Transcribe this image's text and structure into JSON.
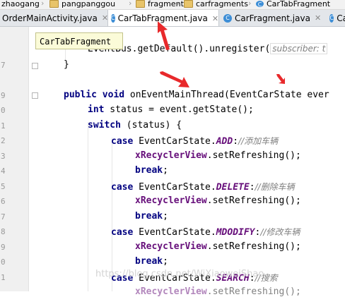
{
  "breadcrumb": {
    "items": [
      "zhaogang",
      "pangpanggou",
      "fragment",
      "carfragments",
      "CarTabFragment"
    ],
    "separator": "›"
  },
  "tabs": [
    {
      "label": "OrderMainActivity.java",
      "active": false
    },
    {
      "label": "CarTabFragment.java",
      "active": true
    },
    {
      "label": "CarFragment.java",
      "active": false
    },
    {
      "label": "Ca",
      "active": false
    }
  ],
  "tooltip": "CarTabFragment",
  "gutter": {
    "line_numbers": [
      "7",
      "9",
      "0",
      "1",
      "2",
      "3",
      "4",
      "5",
      "6",
      "7",
      "8",
      "9",
      "0",
      "1",
      "2",
      "3"
    ]
  },
  "code": {
    "l0": "EventBus.getDefault().unregister(",
    "l0_tail": "subscriber: t",
    "l1": "}",
    "l2_kw1": "public",
    "l2_kw2": "void",
    "l2_rest": " onEventMainThread(EventCarState ever",
    "l3_kw": "int",
    "l3_rest": " status = event.getState();",
    "l4_kw": "switch",
    "l4_rest": " (status) {",
    "case_kw": "case",
    "cls": " EventCarState.",
    "add_const": "ADD",
    "add_comment": ":",
    "add_cm": "//添加车辆",
    "delete_const": "DELETE",
    "delete_cm": "//删除车辆",
    "modify_const": "MDODIFY",
    "modify_cm": "//修改车辆",
    "search_const": "SEARCH",
    "search_cm": "//搜索",
    "field": "xRecyclerView",
    "call": ".setRefreshing();",
    "break_kw": "break",
    "semi": ";",
    "colon": ":"
  },
  "watermark": "https://blog.csdn.net/WiXiaoweiShao",
  "colors": {
    "keyword": "#000080",
    "field": "#660e7a",
    "comment": "#808080",
    "arrow": "#e8292b"
  }
}
